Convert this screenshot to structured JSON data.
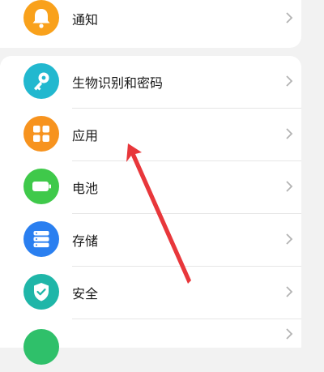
{
  "settings": {
    "items": [
      {
        "label": "通知",
        "icon": "bell-icon",
        "color": "#f9a11b"
      },
      {
        "label": "生物识别和密码",
        "icon": "key-icon",
        "color": "#22b8cf"
      },
      {
        "label": "应用",
        "icon": "apps-grid-icon",
        "color": "#f7931e"
      },
      {
        "label": "电池",
        "icon": "battery-icon",
        "color": "#3fc94a"
      },
      {
        "label": "存储",
        "icon": "storage-icon",
        "color": "#2a7ff0"
      },
      {
        "label": "安全",
        "icon": "shield-check-icon",
        "color": "#1fb6a8"
      }
    ]
  },
  "annotation": {
    "color": "#e8373b",
    "points_to": "应用"
  }
}
